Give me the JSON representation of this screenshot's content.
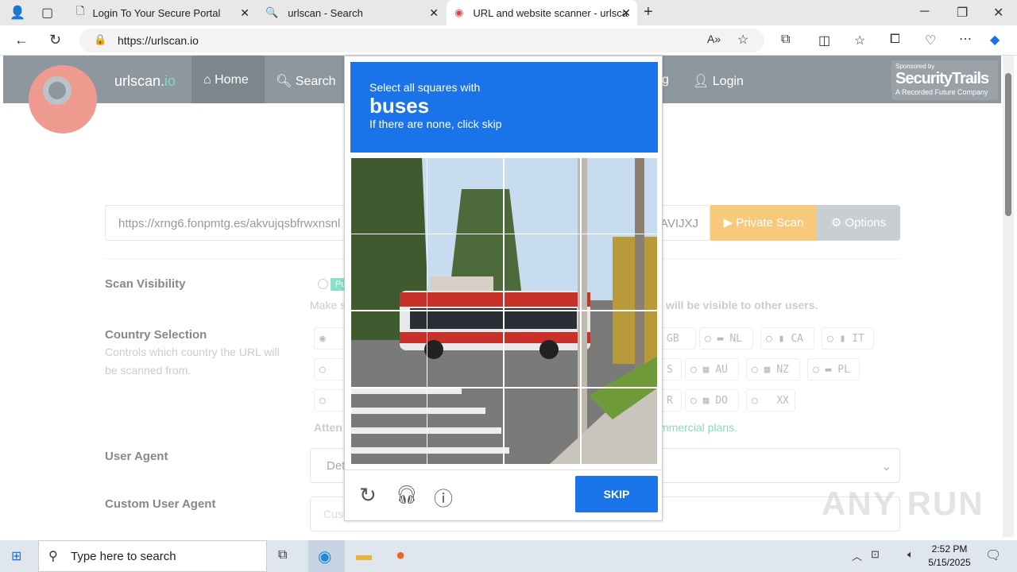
{
  "browser": {
    "tabs": [
      {
        "title": "Login To Your Secure Portal",
        "icon": "page-icon"
      },
      {
        "title": "urlscan - Search",
        "icon": "search-icon"
      },
      {
        "title": "URL and website scanner - urlsca",
        "icon": "urlscan-icon",
        "active": true
      }
    ],
    "url": "https://urlscan.io"
  },
  "site": {
    "brand": "urlscan.io",
    "brand_main": "urlscan.",
    "brand_accent": "io",
    "nav": {
      "home": "Home",
      "search": "Search",
      "partial": "g",
      "login": "Login"
    },
    "sponsor": {
      "small": "Sponsored by",
      "name": "SecurityTrails",
      "tagline": "A Recorded Future Company"
    },
    "url_input_value": "https://xrng6.fonpmtg.es/akvujqsbfrwxnsnl",
    "url_input_tail": "AVIJXJ",
    "private_scan": "Private Scan",
    "options": "Options",
    "scan_visibility": "Scan Visibility",
    "visibility_badge": "Pu",
    "visibility_note_start": "Make s",
    "visibility_note_end": "will be visible to other users.",
    "country_selection": "Country Selection",
    "country_help": "Controls which country the URL will be scanned from.",
    "countries_row1": [
      "GB",
      "NL",
      "CA",
      "IT"
    ],
    "countries_row2": [
      "S",
      "AU",
      "NZ",
      "PL"
    ],
    "countries_row3": [
      "R",
      "DO",
      "XX"
    ],
    "attention_start": "Atten",
    "attention_end": "mmercial plans.",
    "user_agent": "User Agent",
    "user_agent_value": "Det",
    "custom_user_agent": "Custom User Agent",
    "custom_ua_placeholder": "Custom User Agent - This will override the previous option"
  },
  "captcha": {
    "instruction": "Select all squares with",
    "target": "buses",
    "hint": "If there are none, click skip",
    "skip": "SKIP",
    "colors": {
      "primary": "#1a73e8"
    }
  },
  "taskbar": {
    "search_placeholder": "Type here to search",
    "time": "2:52 PM",
    "date": "5/15/2025"
  },
  "watermark": "ANY RUN"
}
